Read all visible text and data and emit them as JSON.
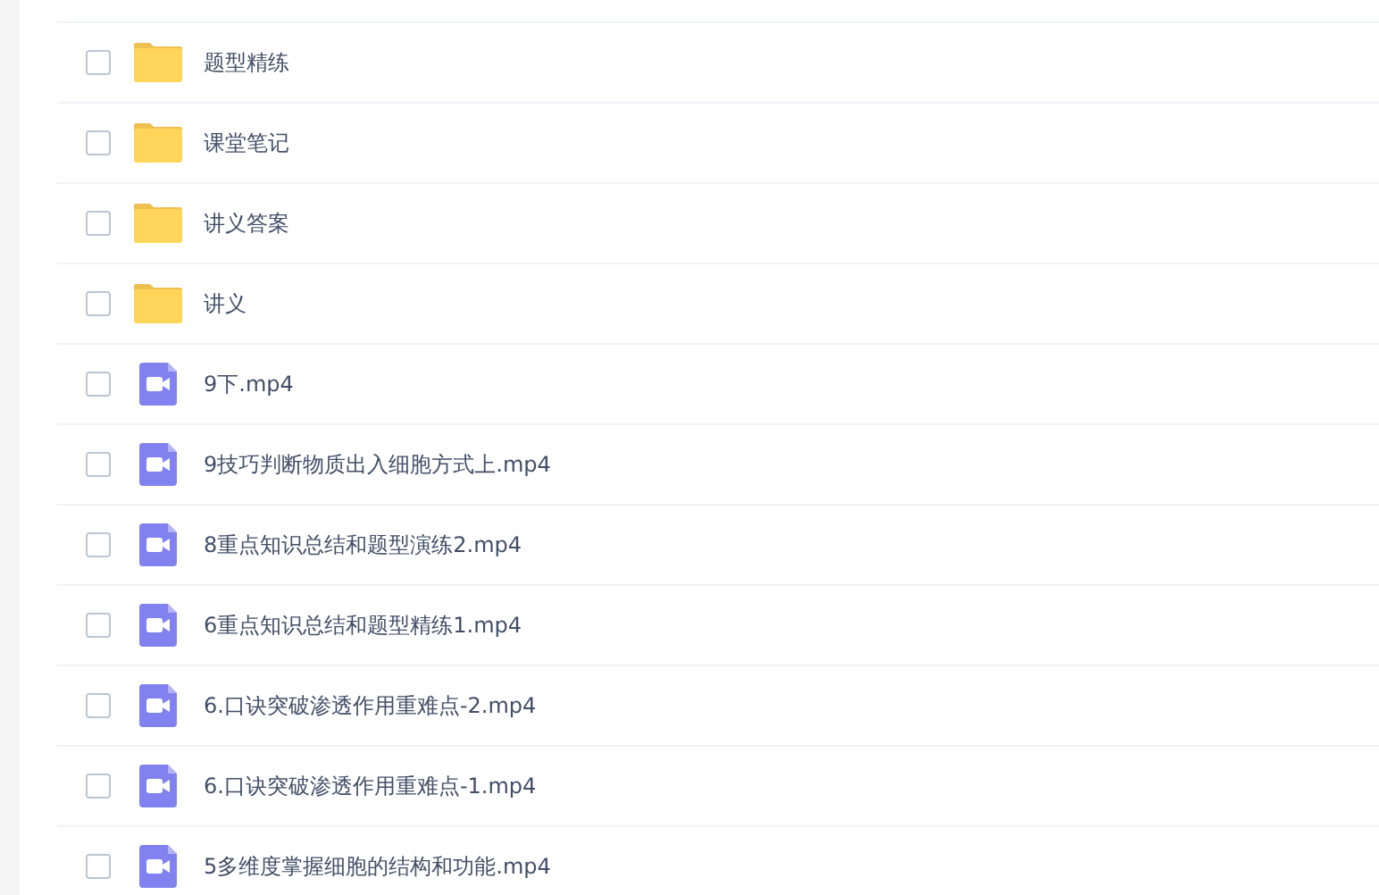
{
  "files": [
    {
      "name": "题型精练",
      "kind": "folder",
      "checked": false
    },
    {
      "name": "课堂笔记",
      "kind": "folder",
      "checked": false
    },
    {
      "name": "讲义答案",
      "kind": "folder",
      "checked": false
    },
    {
      "name": "讲义",
      "kind": "folder",
      "checked": false
    },
    {
      "name": "9下.mp4",
      "kind": "video",
      "checked": false
    },
    {
      "name": "9技巧判断物质出入细胞方式上.mp4",
      "kind": "video",
      "checked": false
    },
    {
      "name": "8重点知识总结和题型演练2.mp4",
      "kind": "video",
      "checked": false
    },
    {
      "name": "6重点知识总结和题型精练1.mp4",
      "kind": "video",
      "checked": false
    },
    {
      "name": "6.口诀突破渗透作用重难点-2.mp4",
      "kind": "video",
      "checked": false
    },
    {
      "name": "6.口诀突破渗透作用重难点-1.mp4",
      "kind": "video",
      "checked": false
    },
    {
      "name": "5多维度掌握细胞的结构和功能.mp4",
      "kind": "video",
      "checked": false
    }
  ]
}
